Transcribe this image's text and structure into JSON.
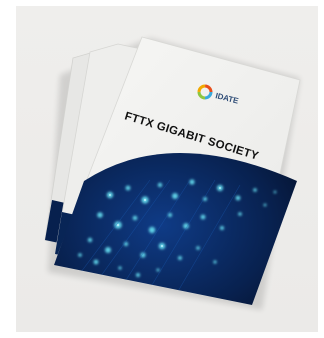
{
  "scene": {
    "backdrop_color": "#ecebe9",
    "cover_color": "#f3f3f1",
    "image_colors": {
      "deep": "#040a1c",
      "mid": "#0b2e6b",
      "glow": "#58c8e0"
    }
  },
  "brochure": {
    "brand": {
      "name": "IDATE",
      "logo_colors": [
        "#3aa9dc",
        "#8dc63f",
        "#f2a900",
        "#e84e1b"
      ]
    },
    "title": "FTTX GIGABIT SOCIETY"
  }
}
